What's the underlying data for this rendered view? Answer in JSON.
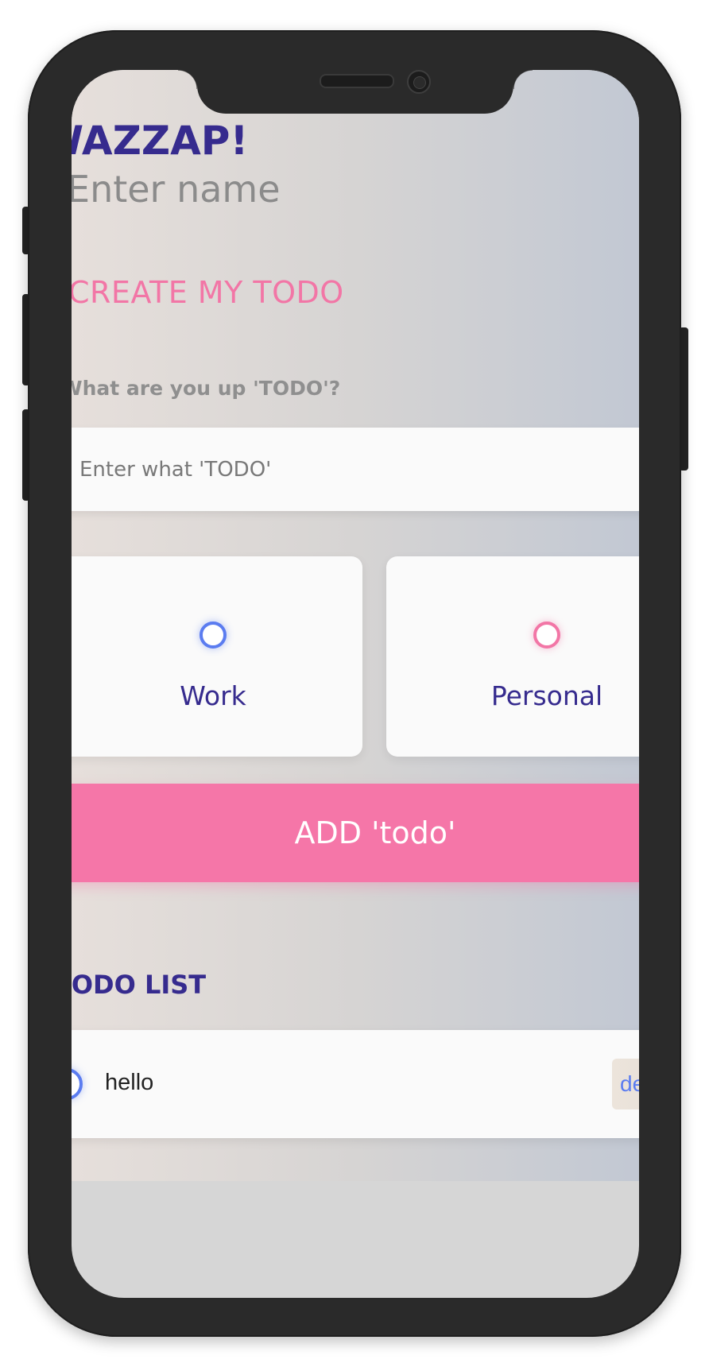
{
  "app": {
    "greeting": "WAZZAP!",
    "name_placeholder": "Enter name"
  },
  "create": {
    "title": "CREATE MY TODO",
    "question": "What are you up 'TODO'?",
    "todo_placeholder": "Enter what 'TODO'",
    "categories": [
      {
        "label": "Work",
        "selected": false,
        "color": "#5b7cf0"
      },
      {
        "label": "Personal",
        "selected": false,
        "color": "#f276a6"
      }
    ],
    "add_button_label": "ADD 'todo'"
  },
  "list": {
    "title": "TODO LIST",
    "items": [
      {
        "text": "hello",
        "done": false,
        "delete_label": "delete"
      }
    ]
  },
  "colors": {
    "primary": "#362b8e",
    "accent_pink": "#f576a8",
    "work_blue": "#5b7cf0",
    "personal_pink": "#f276a6"
  }
}
